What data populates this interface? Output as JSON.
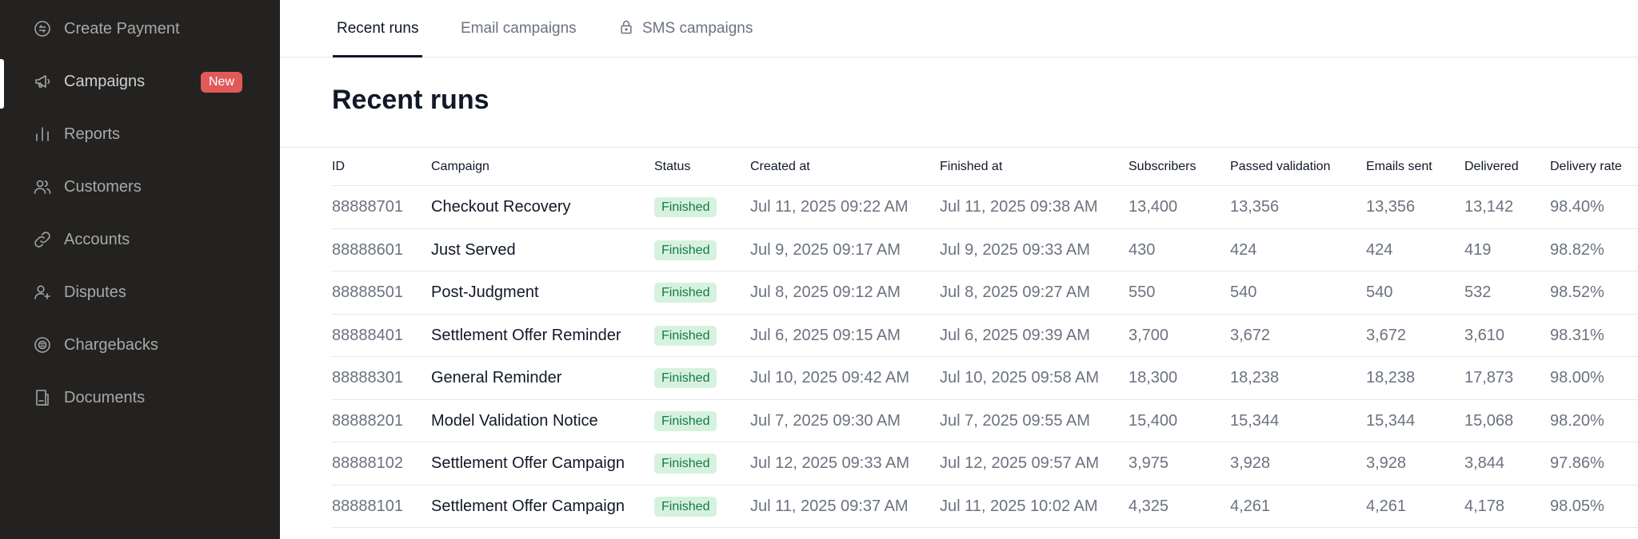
{
  "sidebar": {
    "items": [
      {
        "label": "Create Payment",
        "icon": "payment-circle-icon"
      },
      {
        "label": "Campaigns",
        "icon": "megaphone-icon",
        "badge": "New",
        "active": true
      },
      {
        "label": "Reports",
        "icon": "bar-chart-icon"
      },
      {
        "label": "Customers",
        "icon": "users-icon"
      },
      {
        "label": "Accounts",
        "icon": "link-icon"
      },
      {
        "label": "Disputes",
        "icon": "user-plus-icon"
      },
      {
        "label": "Chargebacks",
        "icon": "refund-circle-icon"
      },
      {
        "label": "Documents",
        "icon": "document-icon"
      }
    ]
  },
  "tabs": [
    {
      "label": "Recent runs",
      "active": true
    },
    {
      "label": "Email campaigns"
    },
    {
      "label": "SMS campaigns",
      "icon": "lock-icon"
    }
  ],
  "page": {
    "title": "Recent runs"
  },
  "table": {
    "headers": [
      "ID",
      "Campaign",
      "Status",
      "Created at",
      "Finished at",
      "Subscribers",
      "Passed validation",
      "Emails sent",
      "Delivered",
      "Delivery rate"
    ],
    "rows": [
      [
        "88888701",
        "Checkout Recovery",
        "Finished",
        "Jul 11, 2025 09:22 AM",
        "Jul 11, 2025 09:38 AM",
        "13,400",
        "13,356",
        "13,356",
        "13,142",
        "98.40%"
      ],
      [
        "88888601",
        "Just Served",
        "Finished",
        "Jul 9, 2025 09:17 AM",
        "Jul 9, 2025 09:33 AM",
        "430",
        "424",
        "424",
        "419",
        "98.82%"
      ],
      [
        "88888501",
        "Post-Judgment",
        "Finished",
        "Jul 8, 2025 09:12 AM",
        "Jul 8, 2025 09:27 AM",
        "550",
        "540",
        "540",
        "532",
        "98.52%"
      ],
      [
        "88888401",
        "Settlement Offer Reminder",
        "Finished",
        "Jul 6, 2025 09:15 AM",
        "Jul 6, 2025 09:39 AM",
        "3,700",
        "3,672",
        "3,672",
        "3,610",
        "98.31%"
      ],
      [
        "88888301",
        "General Reminder",
        "Finished",
        "Jul 10, 2025 09:42 AM",
        "Jul 10, 2025 09:58 AM",
        "18,300",
        "18,238",
        "18,238",
        "17,873",
        "98.00%"
      ],
      [
        "88888201",
        "Model Validation Notice",
        "Finished",
        "Jul 7, 2025 09:30 AM",
        "Jul 7, 2025 09:55 AM",
        "15,400",
        "15,344",
        "15,344",
        "15,068",
        "98.20%"
      ],
      [
        "88888102",
        "Settlement Offer Campaign",
        "Finished",
        "Jul 12, 2025 09:33 AM",
        "Jul 12, 2025 09:57 AM",
        "3,975",
        "3,928",
        "3,928",
        "3,844",
        "97.86%"
      ],
      [
        "88888101",
        "Settlement Offer Campaign",
        "Finished",
        "Jul 11, 2025 09:37 AM",
        "Jul 11, 2025 10:02 AM",
        "4,325",
        "4,261",
        "4,261",
        "4,178",
        "98.05%"
      ]
    ]
  },
  "colors": {
    "sidebar_bg": "#232221",
    "badge_new": "#e05a5a",
    "status_finished_bg": "#d6f2df",
    "status_finished_text": "#137a43"
  }
}
